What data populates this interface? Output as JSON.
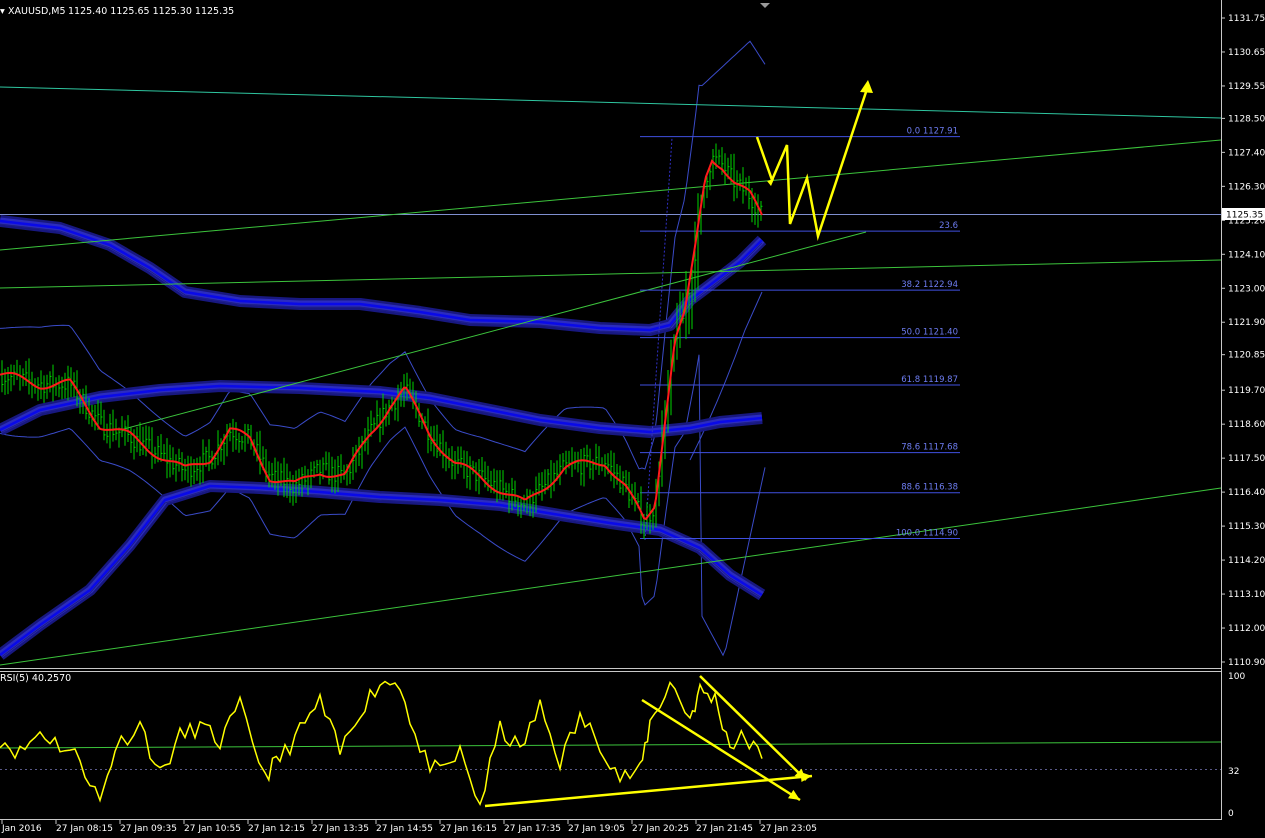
{
  "header": {
    "symbol": "XAUUSD,M5",
    "ohlc": "1125.40 1125.65 1125.30 1125.35"
  },
  "price_axis": {
    "labels": [
      "1131.75",
      "1130.65",
      "1129.55",
      "1128.50",
      "1127.40",
      "1126.30",
      "1125.20",
      "1124.10",
      "1123.00",
      "1121.90",
      "1120.85",
      "1119.70",
      "1118.60",
      "1117.50",
      "1116.40",
      "1115.30",
      "1114.20",
      "1113.10",
      "1112.00",
      "1110.90"
    ],
    "current_price": "1125.35"
  },
  "time_axis": {
    "labels": [
      "Jan 2016",
      "27 Jan 08:15",
      "27 Jan 09:35",
      "27 Jan 10:55",
      "27 Jan 12:15",
      "27 Jan 13:35",
      "27 Jan 14:55",
      "27 Jan 16:15",
      "27 Jan 17:35",
      "27 Jan 19:05",
      "27 Jan 20:25",
      "27 Jan 21:45",
      "27 Jan 23:05"
    ]
  },
  "fibonacci": {
    "levels": [
      {
        "label": "0.0 1127.91",
        "price": 1127.91
      },
      {
        "label": "23.6",
        "price": 1124.85
      },
      {
        "label": "38.2 1122.94",
        "price": 1122.94
      },
      {
        "label": "50.0 1121.40",
        "price": 1121.4
      },
      {
        "label": "61.8 1119.87",
        "price": 1119.87
      },
      {
        "label": "78.6 1117.68",
        "price": 1117.68
      },
      {
        "label": "88.6 1116.38",
        "price": 1116.38
      },
      {
        "label": "100.0 1114.90",
        "price": 1114.9
      }
    ]
  },
  "rsi": {
    "label": "RSI(5) 40.2570",
    "axis_labels": [
      "100",
      "32",
      "0"
    ]
  },
  "colors": {
    "background": "#000000",
    "candles": "#00d400",
    "moving_average": "#ff1a1a",
    "envelope": "#1a1adc",
    "bands": "#3a4bc8",
    "trendlines": "#3cc43c",
    "fibonacci": "#4050e0",
    "annotations": "#ffff00",
    "rsi": "#ffff00"
  },
  "chart_data": {
    "type": "line",
    "title": "XAUUSD,M5",
    "ylim": [
      1110.6,
      1132.3
    ],
    "x": [
      "Jan 2016",
      "27 Jan 08:15",
      "27 Jan 09:35",
      "27 Jan 10:55",
      "27 Jan 12:15",
      "27 Jan 13:35",
      "27 Jan 14:55",
      "27 Jan 16:15",
      "27 Jan 17:35",
      "27 Jan 19:05",
      "27 Jan 20:25",
      "27 Jan 21:45",
      "27 Jan 23:05"
    ],
    "series": [
      {
        "values": [
          1119.9,
          1118.7,
          1117.5,
          1117.6,
          1116.8,
          1117.0,
          1119.8,
          1116.8,
          1116.6,
          1117.3,
          1124.4,
          1126.4,
          1125.35
        ]
      }
    ],
    "rsi": {
      "ylim": [
        0,
        100
      ],
      "values": [
        52,
        36,
        62,
        44,
        40,
        72,
        50,
        48,
        46,
        52,
        80,
        50,
        40
      ]
    }
  }
}
